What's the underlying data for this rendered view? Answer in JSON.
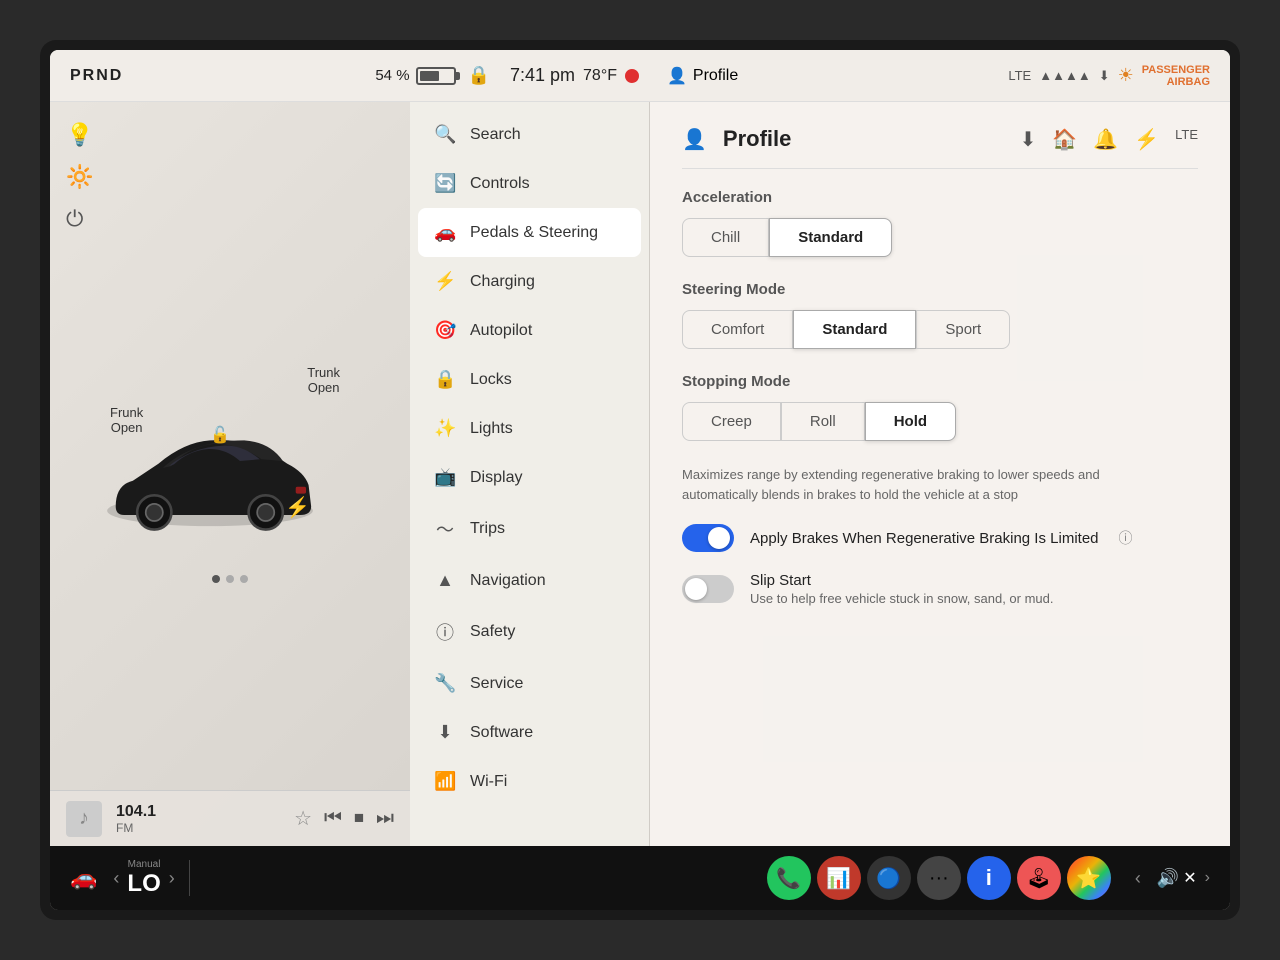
{
  "statusBar": {
    "prnd": "PRND",
    "battery": "54 %",
    "time": "7:41 pm",
    "temp": "78°F",
    "profile": "Profile",
    "lte": "LTE",
    "passengerAirbag": "PASSENGER\nAIRBAG"
  },
  "carPanel": {
    "frunkLabel": "Frunk\nOpen",
    "trunkLabel": "Trunk\nOpen"
  },
  "musicBar": {
    "station": "104.1",
    "stationType": "FM"
  },
  "menu": {
    "search": "Search",
    "controls": "Controls",
    "pedalsAndSteering": "Pedals & Steering",
    "charging": "Charging",
    "autopilot": "Autopilot",
    "locks": "Locks",
    "lights": "Lights",
    "display": "Display",
    "trips": "Trips",
    "navigation": "Navigation",
    "safety": "Safety",
    "service": "Service",
    "software": "Software",
    "wifi": "Wi-Fi"
  },
  "settingsPanel": {
    "title": "Profile",
    "accelerationLabel": "Acceleration",
    "accelOptions": [
      "Chill",
      "Standard"
    ],
    "accelSelected": "Standard",
    "steeringModeLabel": "Steering Mode",
    "steeringOptions": [
      "Comfort",
      "Standard",
      "Sport"
    ],
    "steeringSelected": "Standard",
    "stoppingModeLabel": "Stopping Mode",
    "stoppingOptions": [
      "Creep",
      "Roll",
      "Hold"
    ],
    "stoppingSelected": "Hold",
    "stoppingDesc": "Maximizes range by extending regenerative braking to lower speeds and automatically blends in brakes to hold the vehicle at a stop",
    "applyBrakesLabel": "Apply Brakes When Regenerative Braking Is Limited",
    "applyBrakesOn": true,
    "slipStartLabel": "Slip Start",
    "slipStartDesc": "Use to help free vehicle stuck in snow, sand, or mud.",
    "slipStartOn": false
  },
  "taskbar": {
    "manual": "Manual",
    "lo": "LO"
  }
}
